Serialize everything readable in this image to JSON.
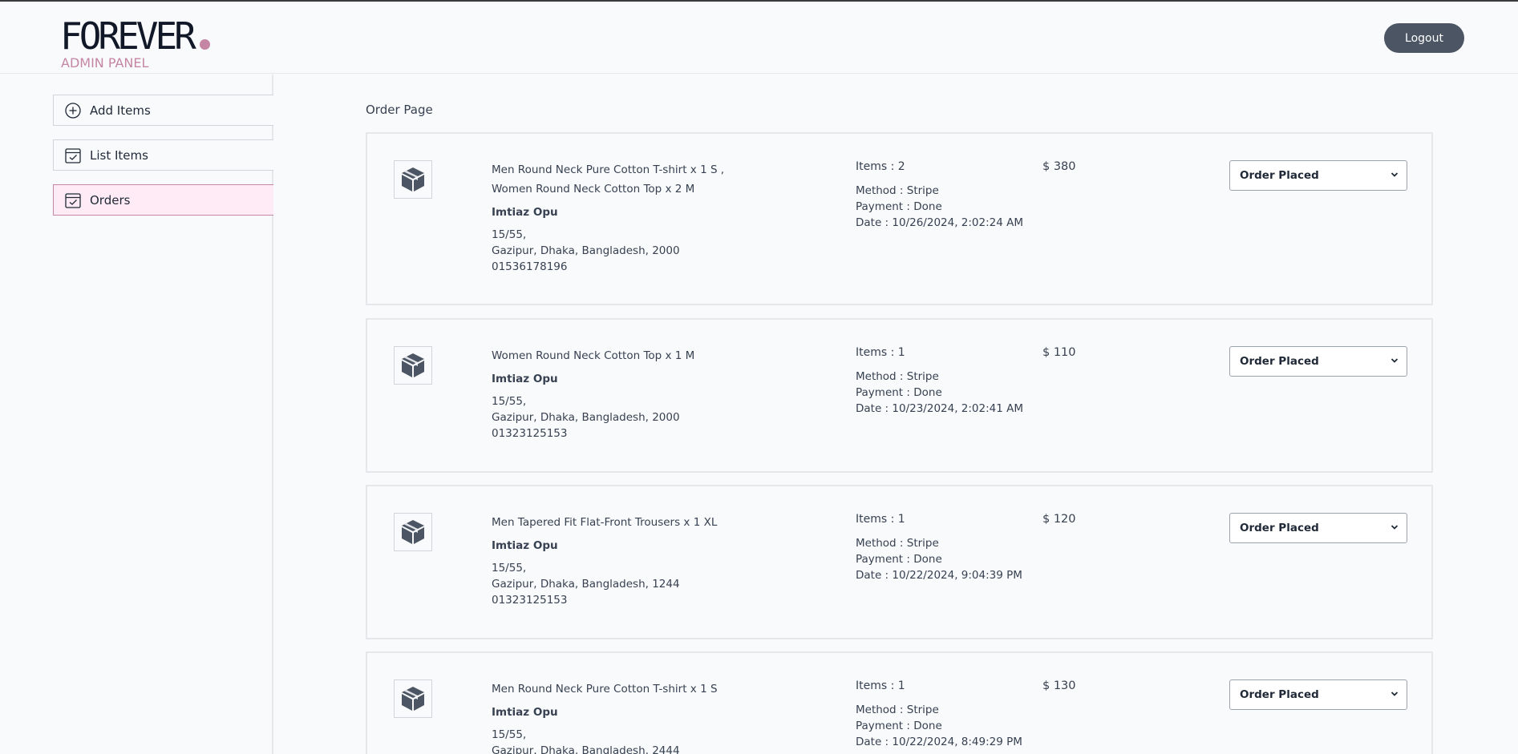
{
  "brand": {
    "logo": "FOREVER",
    "subtitle": "ADMIN PANEL"
  },
  "header": {
    "logout_label": "Logout"
  },
  "sidebar": {
    "items": [
      {
        "label": "Add Items",
        "icon": "plus-circle-icon"
      },
      {
        "label": "List Items",
        "icon": "calendar-check-icon"
      },
      {
        "label": "Orders",
        "icon": "calendar-check-icon"
      }
    ]
  },
  "main": {
    "title": "Order Page"
  },
  "orders": [
    {
      "products": [
        "Men Round Neck Pure Cotton T-shirt x 1 S ,",
        "Women Round Neck Cotton Top x 2 M"
      ],
      "customer": "Imtiaz Opu",
      "address_line1": "15/55,",
      "address_line2": "Gazipur, Dhaka, Bangladesh, 2000",
      "phone": "01536178196",
      "items_count": "Items : 2",
      "method": "Method : Stripe",
      "payment": "Payment : Done",
      "date": "Date : 10/26/2024, 2:02:24 AM",
      "amount": "$ 380",
      "status": "Order Placed"
    },
    {
      "products": [
        "Women Round Neck Cotton Top x 1 M"
      ],
      "customer": "Imtiaz Opu",
      "address_line1": "15/55,",
      "address_line2": "Gazipur, Dhaka, Bangladesh, 2000",
      "phone": "01323125153",
      "items_count": "Items : 1",
      "method": "Method : Stripe",
      "payment": "Payment : Done",
      "date": "Date : 10/23/2024, 2:02:41 AM",
      "amount": "$ 110",
      "status": "Order Placed"
    },
    {
      "products": [
        "Men Tapered Fit Flat-Front Trousers x 1 XL"
      ],
      "customer": "Imtiaz Opu",
      "address_line1": "15/55,",
      "address_line2": "Gazipur, Dhaka, Bangladesh, 1244",
      "phone": "01323125153",
      "items_count": "Items : 1",
      "method": "Method : Stripe",
      "payment": "Payment : Done",
      "date": "Date : 10/22/2024, 9:04:39 PM",
      "amount": "$ 120",
      "status": "Order Placed"
    },
    {
      "products": [
        "Men Round Neck Pure Cotton T-shirt x 1 S"
      ],
      "customer": "Imtiaz Opu",
      "address_line1": "15/55,",
      "address_line2": "Gazipur, Dhaka, Bangladesh, 2444",
      "phone": "",
      "items_count": "Items : 1",
      "method": "Method : Stripe",
      "payment": "Payment : Done",
      "date": "Date : 10/22/2024, 8:49:29 PM",
      "amount": "$ 130",
      "status": "Order Placed"
    }
  ],
  "colors": {
    "accent": "#c586a5",
    "active_bg": "#ffebf5",
    "button": "#4b5563"
  }
}
